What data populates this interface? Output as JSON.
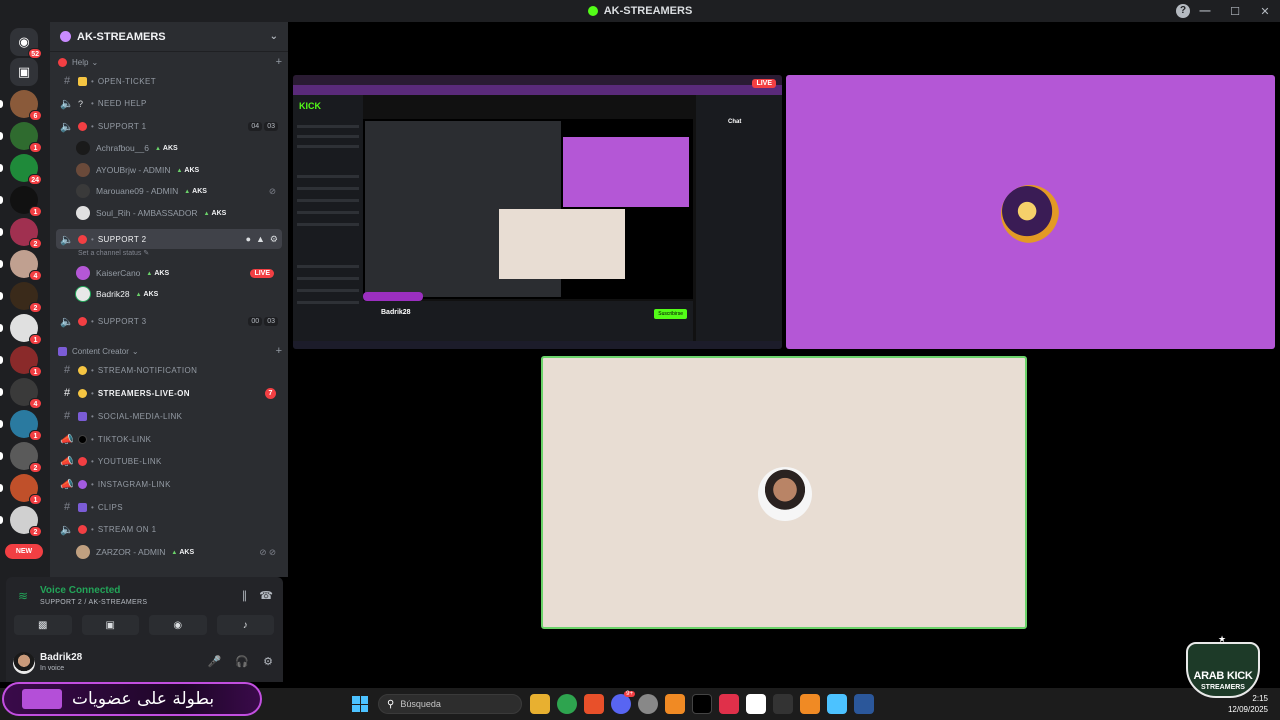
{
  "window": {
    "title": "AK-STREAMERS",
    "controls": [
      "—",
      "☐",
      "✕"
    ],
    "help": "?"
  },
  "rail": {
    "home_badge": "52",
    "servers": [
      {
        "badge": "6",
        "color": "#8a5a3a"
      },
      {
        "badge": "1",
        "color": "#2f6b2f"
      },
      {
        "badge": "24",
        "color": "#1f8a3a"
      },
      {
        "badge": "1",
        "color": "#111111"
      },
      {
        "badge": "2",
        "color": "#a03050"
      },
      {
        "badge": "4",
        "color": "#c0a090"
      },
      {
        "badge": "2",
        "color": "#3a2a1a"
      },
      {
        "badge": "1",
        "color": "#e0e0e0"
      },
      {
        "badge": "1",
        "color": "#8a2a2a"
      },
      {
        "badge": "4",
        "color": "#3a3a3a"
      },
      {
        "badge": "1",
        "color": "#2a7aa0"
      },
      {
        "badge": "2",
        "color": "#5a5a5a"
      },
      {
        "badge": "1",
        "color": "#c0502a"
      },
      {
        "badge": "2",
        "color": "#d0d0d0"
      }
    ],
    "new_label": "NEW"
  },
  "sidebar": {
    "guild_name": "AK-STREAMERS",
    "categories": {
      "help": "Help",
      "content_creator": "Content Creator"
    },
    "channels": {
      "open_ticket": "OPEN-TICKET",
      "need_help": "NEED HELP",
      "support1": "SUPPORT 1",
      "support2": "SUPPORT 2",
      "support3": "SUPPORT 3",
      "stream_notification": "STREAM-NOTIFICATION",
      "streamers_live_on": "STREAMERS-LIVE-ON",
      "social_media_link": "SOCIAL-MEDIA-LINK",
      "tiktok_link": "TIKTOK-LINK",
      "youtube_link": "YOUTUBE-LINK",
      "instagram_link": "INSTAGRAM-LINK",
      "clips": "CLIPS",
      "stream_on_1": "STREAM ON 1"
    },
    "support1_counts": [
      "04",
      "03"
    ],
    "support3_counts": [
      "00",
      "03"
    ],
    "support2_status": "Set a channel status",
    "streamers_live_unread": "7",
    "tag": "AKS",
    "live_label": "LIVE",
    "support1_users": [
      "Achrafbou__6",
      "AYOUBrjw - ADMIN",
      "Marouane09 - ADMIN",
      "Soul_Rih - AMBASSADOR"
    ],
    "support2_users": [
      "KaiserCano",
      "Badrik28"
    ],
    "stream_on_1_users": [
      "ZARZOR - ADMIN"
    ]
  },
  "voice": {
    "title": "Voice Connected",
    "subtitle": "SUPPORT 2 / AK-STREAMERS"
  },
  "user": {
    "name": "Badrik28",
    "status": "In voice"
  },
  "screen_share": {
    "live_label": "LIVE",
    "kick_logo": "KICK",
    "chat_title": "Chat",
    "streamer": "Badrik28",
    "subscribe": "Suscribirse"
  },
  "taskbar": {
    "search_placeholder": "Búsqueda",
    "discord_badge": "9+",
    "time": "2:15",
    "date": "12/09/2025"
  },
  "overlay": {
    "arabic_text": "بطولة على عضويات",
    "watermark_line1": "ARAB KICK",
    "watermark_line2": "STREAMERS"
  }
}
